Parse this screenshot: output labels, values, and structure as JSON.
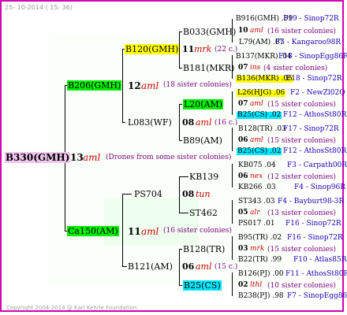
{
  "header": {
    "date": "25- 10-2014 ( 15: 36)"
  },
  "footer": {
    "copyright": "Copyright 2004-2014 @ Karl Kehrle Foundation."
  },
  "root": {
    "name": "B330(GMH)",
    "gen": "13",
    "trait": "aml",
    "note": "(Drones from some sister colonies)"
  },
  "gen1": [
    {
      "name": "B206(GMH)",
      "gen": "12",
      "trait": "aml",
      "note": "(18 sister colonies)"
    },
    {
      "name": "Ca150(AM)",
      "gen": "11",
      "trait": "aml",
      "note": "(16 sister colonies)"
    }
  ],
  "gen2": [
    {
      "name": "B120(GMH)",
      "gen": "11",
      "trait": "mrk",
      "note": "(22 c.)"
    },
    {
      "name": "L083(WF)",
      "gen": "08",
      "trait": "aml",
      "note": "(16 c.)"
    },
    {
      "name": "PS704",
      "gen": "08",
      "trait": "tun",
      "note": ""
    },
    {
      "name": "B121(AM)",
      "gen": "06",
      "trait": "aml",
      "note": "(15 c.)"
    }
  ],
  "gen3": [
    {
      "name": "B033(GMH)"
    },
    {
      "name": "B181(MKR)"
    },
    {
      "name": "L20(AM)"
    },
    {
      "name": "B89(AM)"
    },
    {
      "name": "KB139"
    },
    {
      "name": "ST462"
    },
    {
      "name": "B128(TR)"
    },
    {
      "name": "B25(CS)"
    }
  ],
  "gen4": [
    {
      "left": "B916(GMH) .09",
      "right": "F19 - Sinop72R",
      "gen": "10",
      "trait": "aml",
      "note": "(16 sister colonies)",
      "left2": "L79(AM) .07",
      "right2": "F5 - Kangaroo98R"
    },
    {
      "left": "B137(MKR) .04",
      "right": "F18 - SinopEgg86R",
      "gen": "07",
      "trait": "ins",
      "note": "(4 sister colonies)",
      "left2": "B136(MKR) .05",
      "right2": "F18 - Sinop72R"
    },
    {
      "left": "L26(HJG) .06",
      "right": "F2 - NewZl02Q",
      "gen": "07",
      "trait": "aml",
      "note": "(15 sister colonies)",
      "left2": "B25(CS) .02",
      "right2": "F12 - AthosSt80R"
    },
    {
      "left": "B128(TR) .03",
      "right": "F17 - Sinop72R",
      "gen": "06",
      "trait": "aml",
      "note": "(15 sister colonies)",
      "left2": "B25(CS) .02",
      "right2": "F12 - AthosSt80R"
    },
    {
      "left": "KB075 .04",
      "right": "F3 - Carpath00R",
      "gen": "06",
      "trait": "nex",
      "note": "(12 sister colonies)",
      "left2": "KB266 .03",
      "right2": "F4 - Sinop96R"
    },
    {
      "left": "ST343 .03",
      "right": "F4 - Bayburt98-3R",
      "gen": "05",
      "trait": "alr",
      "note": "(13 sister colonies)",
      "left2": "PS017 .01",
      "right2": "F16 - Sinop72R"
    },
    {
      "left": "B95(TR) .02",
      "right": "F16 - Sinop72R",
      "gen": "03",
      "trait": "mrk",
      "note": "(15 sister colonies)",
      "left2": "B22(TR) .99",
      "right2": "F10 - Atlas85R"
    },
    {
      "left": "B126(PJ) .00",
      "right": "F11 - AthosSt80R",
      "gen": "02",
      "trait": "lthl",
      "note": "(10 sister colonies)",
      "left2": "B238(PJ) .98",
      "right2": "F7 - SinopEgg86R"
    }
  ]
}
